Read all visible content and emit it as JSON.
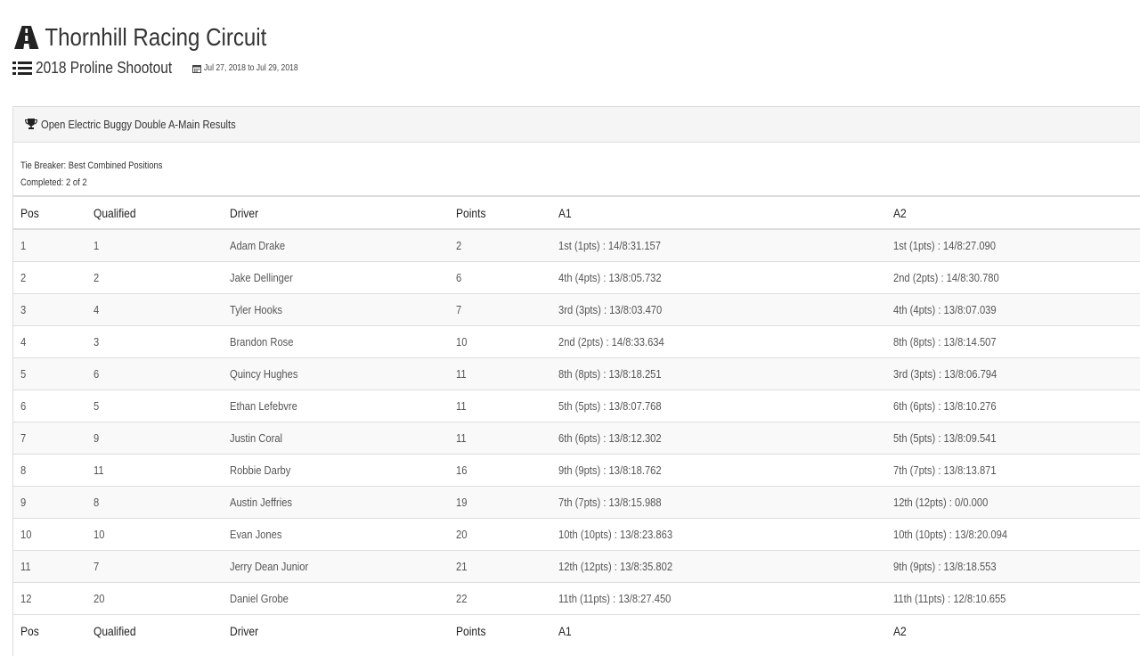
{
  "header": {
    "track_name": "Thornhill Racing Circuit",
    "event_name": "2018 Proline Shootout",
    "event_dates": "Jul 27, 2018 to Jul 29, 2018",
    "icons": {
      "track": "road-icon",
      "event": "list-icon",
      "dates": "calendar-icon"
    }
  },
  "panel": {
    "title": "Open Electric Buggy Double A-Main Results",
    "title_icon": "trophy-icon",
    "tie_breaker": "Tie Breaker: Best Combined Positions",
    "completed": "Completed: 2 of 2"
  },
  "table": {
    "columns": [
      "Pos",
      "Qualified",
      "Driver",
      "Points",
      "A1",
      "A2"
    ],
    "rows": [
      [
        "1",
        "1",
        "Adam Drake",
        "2",
        "1st (1pts) : 14/8:31.157",
        "1st (1pts) : 14/8:27.090"
      ],
      [
        "2",
        "2",
        "Jake Dellinger",
        "6",
        "4th (4pts) : 13/8:05.732",
        "2nd (2pts) : 14/8:30.780"
      ],
      [
        "3",
        "4",
        "Tyler Hooks",
        "7",
        "3rd (3pts) : 13/8:03.470",
        "4th (4pts) : 13/8:07.039"
      ],
      [
        "4",
        "3",
        "Brandon Rose",
        "10",
        "2nd (2pts) : 14/8:33.634",
        "8th (8pts) : 13/8:14.507"
      ],
      [
        "5",
        "6",
        "Quincy Hughes",
        "11",
        "8th (8pts) : 13/8:18.251",
        "3rd (3pts) : 13/8:06.794"
      ],
      [
        "6",
        "5",
        "Ethan Lefebvre",
        "11",
        "5th (5pts) : 13/8:07.768",
        "6th (6pts) : 13/8:10.276"
      ],
      [
        "7",
        "9",
        "Justin Coral",
        "11",
        "6th (6pts) : 13/8:12.302",
        "5th (5pts) : 13/8:09.541"
      ],
      [
        "8",
        "11",
        "Robbie Darby",
        "16",
        "9th (9pts) : 13/8:18.762",
        "7th (7pts) : 13/8:13.871"
      ],
      [
        "9",
        "8",
        "Austin Jeffries",
        "19",
        "7th (7pts) : 13/8:15.988",
        "12th (12pts) : 0/0.000"
      ],
      [
        "10",
        "10",
        "Evan Jones",
        "20",
        "10th (10pts) : 13/8:23.863",
        "10th (10pts) : 13/8:20.094"
      ],
      [
        "11",
        "7",
        "Jerry Dean Junior",
        "21",
        "12th (12pts) : 13/8:35.802",
        "9th (9pts) : 13/8:18.553"
      ],
      [
        "12",
        "20",
        "Daniel Grobe",
        "22",
        "11th (11pts) : 13/8:27.450",
        "11th (11pts) : 12/8:10.655"
      ]
    ]
  }
}
